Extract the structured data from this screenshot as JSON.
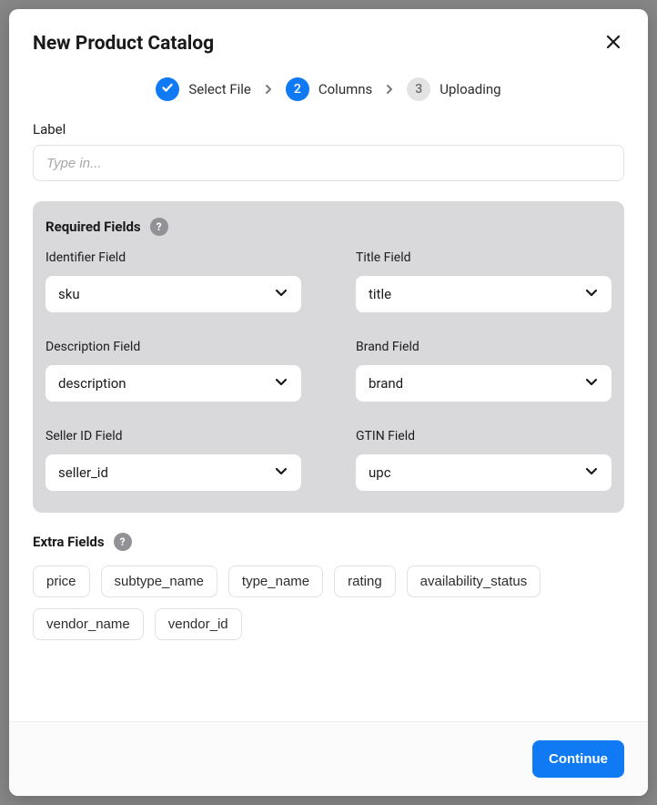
{
  "modal": {
    "title": "New Product Catalog"
  },
  "stepper": {
    "steps": [
      {
        "num": "1",
        "label": "Select File",
        "state": "done"
      },
      {
        "num": "2",
        "label": "Columns",
        "state": "active"
      },
      {
        "num": "3",
        "label": "Uploading",
        "state": "pending"
      }
    ]
  },
  "labelField": {
    "label": "Label",
    "placeholder": "Type in...",
    "value": ""
  },
  "requiredSection": {
    "title": "Required Fields",
    "help": "?",
    "fields": [
      {
        "label": "Identifier Field",
        "value": "sku"
      },
      {
        "label": "Title Field",
        "value": "title"
      },
      {
        "label": "Description Field",
        "value": "description"
      },
      {
        "label": "Brand Field",
        "value": "brand"
      },
      {
        "label": "Seller ID Field",
        "value": "seller_id"
      },
      {
        "label": "GTIN Field",
        "value": "upc"
      }
    ]
  },
  "extraSection": {
    "title": "Extra Fields",
    "help": "?",
    "chips": [
      "price",
      "subtype_name",
      "type_name",
      "rating",
      "availability_status",
      "vendor_name",
      "vendor_id"
    ]
  },
  "footer": {
    "continue": "Continue"
  }
}
